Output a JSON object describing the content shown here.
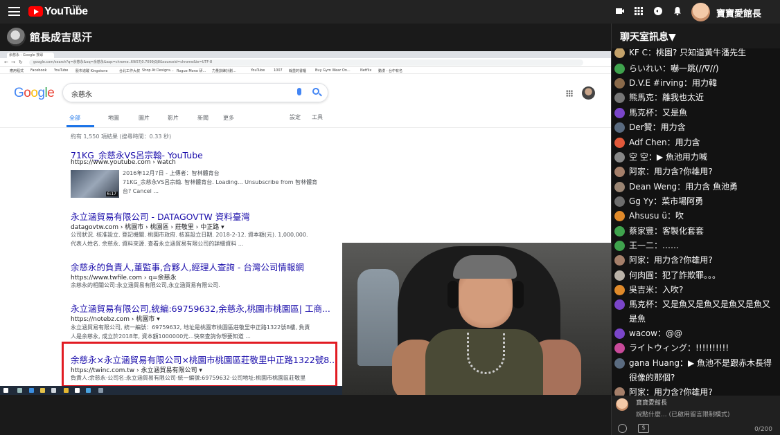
{
  "topbar": {
    "logo_text": "YouTube",
    "logo_region": "TW",
    "username": "寶寶愛館長",
    "icons": [
      "menu-icon",
      "youtube-logo-icon",
      "create-video-icon",
      "apps-grid-icon",
      "chat-bubble-icon",
      "bell-icon",
      "avatar"
    ]
  },
  "channel": {
    "name": "館長成吉思汗"
  },
  "chat_header": {
    "title": "聊天室訊息▼"
  },
  "browser": {
    "tab_title": "余慈永 - Google 搜尋",
    "address": "google.com/search?q=余慈永&oq=余慈永&aqs=chrome..69i57j0.7099j0j8&sourceid=chrome&ie=UTF-8",
    "bookmarks": [
      "應用程式",
      "Facebook",
      "YouTube",
      "股市追蹤 Kingstone",
      "台北工作大叔",
      "Shop At Designs...",
      "Rogue Mono 研...",
      "力量訓練計劃...",
      "YouTube",
      "1007",
      "翰墨的書櫃",
      "Buy Gym Wear On...",
      "Netflix",
      "動漫 - 台中有名"
    ]
  },
  "google": {
    "logo": "Google",
    "query": "余慈永",
    "tabs": [
      "全部",
      "地圖",
      "圖片",
      "影片",
      "新聞",
      "更多"
    ],
    "tools": [
      "設定",
      "工具"
    ],
    "stats": "約有 1,550 項結果 (搜尋時間：0.33 秒)",
    "results": [
      {
        "title": "71KG_余慈永VS呂宗翰- YouTube",
        "url": "https://www.youtube.com › watch",
        "snippet1": "2016年12月7日 - 上傳者：智林體育台",
        "snippet2": "71KG_余慈永VS呂宗翰. 智林體育台. Loading... Unsubscribe from 智林體育",
        "snippet3": "台? Cancel ...",
        "duration": "6:17"
      },
      {
        "title": "永立涵貿易有限公司 - DATAGOVTW 資料臺灣",
        "url": "datagovtw.com › 桃園市 › 桃園區 › 莊敬里 › 中正路 ▾",
        "snippet1": "公司狀況. 核准設立. 登記機關. 桃園市政府. 核准設立日期. 2018-2-12. 資本額(元). 1,000,000.",
        "snippet2": "代表人姓名. 余慈永. 資料來源. 查看永立涵貿易有限公司的詳細資料 ..."
      },
      {
        "title": "余慈永的負責人,董監事,合夥人,經理人查詢 - 台灣公司情報網",
        "url": "https://www.twfile.com › q=余慈永",
        "snippet1": "余慈永的相關公司:永立涵貿易有限公司,永立涵貿易有限公司."
      },
      {
        "title": "永立涵貿易有限公司,統編:69759632,余慈永,桃園市桃園區| 工商...",
        "url": "https://notebz.com › 桃園市 ▾",
        "snippet1": "永立涵貿易有限公司, 統一編號：69759632, 地址是桃園市桃園區莊敬里中正路1322號8樓, 負責",
        "snippet2": "人是余慈永, 成立於2018年, 資本額1000000元...快來查詢你想要知道 ..."
      },
      {
        "title": "余慈永×永立涵貿易有限公司×桃園市桃園區莊敬里中正路1322號8...",
        "url": "https://twinc.com.tw › 永立涵貿易有限公司 ▾",
        "snippet1": "負責人:余慈永·公司名:永立涵貿易有限公司·統一編號:69759632·公司地址:桃園市桃園區莊敬里"
      }
    ]
  },
  "chat": {
    "messages": [
      {
        "author": "KF C",
        "text": "桃園? 只知道黃牛潘先生",
        "color": "#c4a26a"
      },
      {
        "author": "らいれい",
        "text": "嚇一跳(//∇//)",
        "color": "#3fa34d"
      },
      {
        "author": "D.V.E #irving",
        "text": "用力韓",
        "color": "#8a6a4a"
      },
      {
        "author": "熊馬克",
        "text": "離我也太近",
        "color": "#777777"
      },
      {
        "author": "馬克杯",
        "text": "又是魚",
        "color": "#7a45c9"
      },
      {
        "author": "Der贊",
        "text": "用力含",
        "color": "#5a6b80"
      },
      {
        "author": "Adf Chen",
        "text": "用力含",
        "color": "#e2593b"
      },
      {
        "author": "空 空",
        "text": "▶ 魚池用力喊",
        "color": "#888888"
      },
      {
        "author": "阿家",
        "text": "用力含?你雄用?",
        "color": "#a57f6a"
      },
      {
        "author": "Dean Weng",
        "text": "用力含 魚池勇",
        "color": "#9a8573"
      },
      {
        "author": "Gg Yy",
        "text": "菜市場阿勇",
        "color": "#6d6d6d"
      },
      {
        "author": "Ahsusu ü",
        "text": "吹",
        "color": "#e08a2a"
      },
      {
        "author": "蔡家豐",
        "text": "客製化套套",
        "color": "#3fa34d"
      },
      {
        "author": "王一二",
        "text": "……",
        "color": "#3fa34d"
      },
      {
        "author": "阿家",
        "text": "用力含?你雄用?",
        "color": "#a57f6a"
      },
      {
        "author": "何肉圓",
        "text": "犯了詐欺罪。。。",
        "color": "#b9b2a8"
      },
      {
        "author": "吳吉米",
        "text": "入吹?",
        "color": "#e08a2a"
      },
      {
        "author": "馬克杯",
        "text": "又是魚又是魚又是魚又是魚又是魚",
        "color": "#7a45c9"
      },
      {
        "author": "wacow",
        "text": "@@",
        "color": "#7a45c9"
      },
      {
        "author": "ライトウィング",
        "text": "!!!!!!!!!!",
        "color": "#c94a9a"
      },
      {
        "author": "gana Huang",
        "text": "▶ 魚池不是跟赤木長得很像的那個?",
        "color": "#5a6b80"
      },
      {
        "author": "阿家",
        "text": "用力含?你雄用?",
        "color": "#a57f6a"
      }
    ]
  },
  "composer": {
    "username": "寶寶愛館長",
    "placeholder": "說點什麼... (已啟用留言限制模式)",
    "counter": "0/200"
  }
}
